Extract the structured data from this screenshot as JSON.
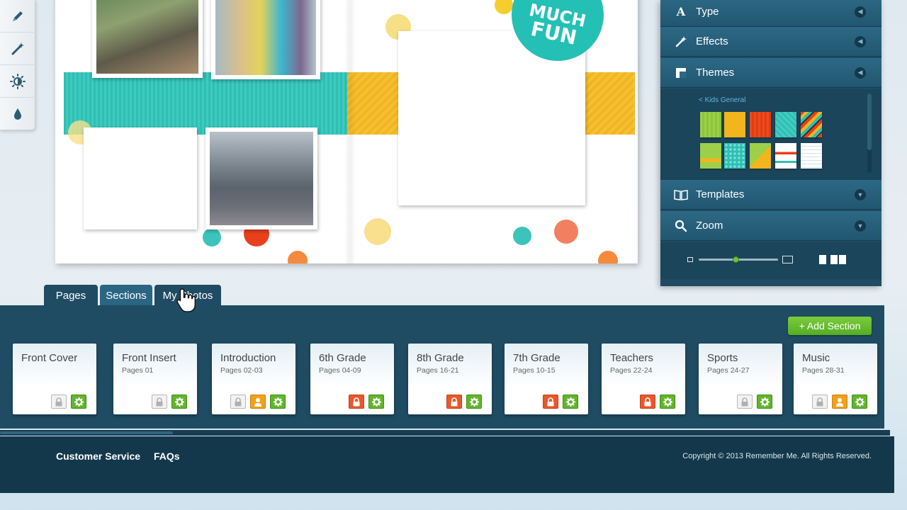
{
  "left_toolbar": {
    "tools": [
      "pen-icon",
      "magic-wand-icon",
      "brightness-icon",
      "drop-icon"
    ]
  },
  "spread": {
    "badge_lines": [
      "MUCH",
      "FUN"
    ]
  },
  "right_panel": {
    "type_label": "Type",
    "effects_label": "Effects",
    "themes_label": "Themes",
    "kids_link": "< Kids General",
    "templates_label": "Templates",
    "zoom_label": "Zoom",
    "zoom_level": 0.47
  },
  "tabs": [
    {
      "label": "Pages"
    },
    {
      "label": "Sections"
    },
    {
      "label": "My Photos"
    }
  ],
  "sections_panel": {
    "add_button": "+ Add Section",
    "cards": [
      {
        "title": "Front Cover",
        "pages": "",
        "buttons": [
          "lock-grey",
          "gear"
        ]
      },
      {
        "title": "Front Insert",
        "pages": "Pages 01",
        "buttons": [
          "lock-grey",
          "gear"
        ]
      },
      {
        "title": "Introduction",
        "pages": "Pages 02-03",
        "buttons": [
          "lock-grey",
          "user",
          "gear"
        ]
      },
      {
        "title": "6th Grade",
        "pages": "Pages 04-09",
        "buttons": [
          "lock-red",
          "gear"
        ]
      },
      {
        "title": "8th Grade",
        "pages": "Pages 16-21",
        "buttons": [
          "lock-red",
          "gear"
        ]
      },
      {
        "title": "7th Grade",
        "pages": "Pages 10-15",
        "buttons": [
          "lock-red",
          "gear"
        ]
      },
      {
        "title": "Teachers",
        "pages": "Pages 22-24",
        "buttons": [
          "lock-red",
          "gear"
        ]
      },
      {
        "title": "Sports",
        "pages": "Pages 24-27",
        "buttons": [
          "lock-grey",
          "gear"
        ]
      },
      {
        "title": "Music",
        "pages": "Pages 28-31",
        "buttons": [
          "lock-grey",
          "user",
          "gear"
        ]
      }
    ]
  },
  "footer": {
    "customer_service": "Customer Service",
    "faqs": "FAQs",
    "copyright": "Copyright © 2013 Remember Me. All Rights Reserved."
  },
  "colors": {
    "panel": "#1f4c63",
    "teal": "#2fbfb4",
    "yellow": "#f2b51c",
    "green_button": "#62b52c",
    "red_lock": "#e9572c",
    "orange_user": "#f0a21b"
  }
}
